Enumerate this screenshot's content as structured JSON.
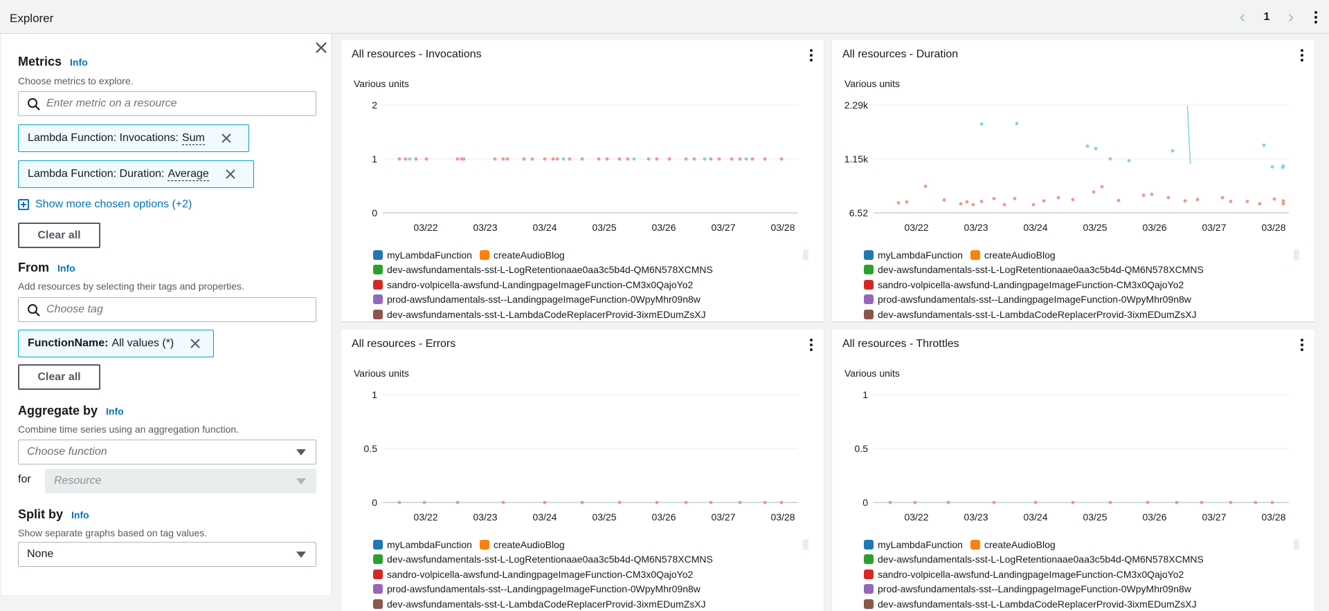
{
  "header": {
    "title": "Explorer",
    "page": "1"
  },
  "sidebar": {
    "metrics": {
      "heading": "Metrics",
      "info": "Info",
      "desc": "Choose metrics to explore.",
      "placeholder": "Enter metric on a resource",
      "tokens": [
        {
          "label": "Lambda Function: Invocations:",
          "stat": "Sum"
        },
        {
          "label": "Lambda Function: Duration:",
          "stat": "Average"
        }
      ],
      "more_link": "Show more chosen options (+2)",
      "clear": "Clear all"
    },
    "from": {
      "heading": "From",
      "info": "Info",
      "desc": "Add resources by selecting their tags and properties.",
      "placeholder": "Choose tag",
      "token_key": "FunctionName:",
      "token_val": "All values (*)",
      "clear": "Clear all"
    },
    "aggregate": {
      "heading": "Aggregate by",
      "info": "Info",
      "desc": "Combine time series using an aggregation function.",
      "function_placeholder": "Choose function",
      "for_label": "for",
      "resource_placeholder": "Resource"
    },
    "split": {
      "heading": "Split by",
      "info": "Info",
      "desc": "Show separate graphs based on tag values.",
      "value": "None"
    }
  },
  "colors": {
    "link": "#0073bb",
    "token_border": "#00a1c9",
    "series_teal": "#7fd3e6",
    "series_salmon": "#f2968c"
  },
  "legend": [
    {
      "name": "myLambdaFunction",
      "color": "#1f77b4"
    },
    {
      "name": "createAudioBlog",
      "color": "#ff7f0e"
    },
    {
      "name": "dev-awsfundamentals-sst-L-LogRetentionaae0aa3c5b4d-QM6N578XCMNS",
      "color": "#2ca02c"
    },
    {
      "name": "sandro-volpicella-awsfund-LandingpageImageFunction-CM3x0QajoYo2",
      "color": "#d62728"
    },
    {
      "name": "prod-awsfundamentals-sst--LandingpageImageFunction-0WpyMhr09n8w",
      "color": "#9467bd"
    },
    {
      "name": "dev-awsfundamentals-sst-L-LambdaCodeReplacerProvid-3ixmEDumZsXJ",
      "color": "#8c564b"
    }
  ],
  "chart_data": [
    {
      "type": "scatter",
      "title": "All resources - Invocations",
      "ylabel": "Various units",
      "ylim": [
        0,
        2
      ],
      "yticks": [
        "0",
        "1",
        "2"
      ],
      "categories": [
        "03/22",
        "03/23",
        "03/24",
        "03/25",
        "03/26",
        "03/27",
        "03/28"
      ],
      "series": [
        {
          "name": "createAudioBlog",
          "color": "#f2968c",
          "points": [
            [
              -1.9,
              1
            ],
            [
              -1.75,
              1
            ],
            [
              -1.5,
              1
            ],
            [
              -1.25,
              1
            ],
            [
              -0.5,
              1
            ],
            [
              -0.4,
              1
            ],
            [
              -0.35,
              1
            ],
            [
              0.4,
              1
            ],
            [
              0.6,
              1
            ],
            [
              0.7,
              1
            ],
            [
              1.1,
              1
            ],
            [
              1.3,
              1
            ],
            [
              1.6,
              1
            ],
            [
              1.8,
              1
            ],
            [
              1.9,
              1
            ],
            [
              2.2,
              1
            ],
            [
              2.5,
              1
            ],
            [
              2.9,
              1
            ],
            [
              3.1,
              1
            ],
            [
              3.4,
              1
            ],
            [
              3.6,
              1
            ],
            [
              4.1,
              1
            ],
            [
              4.3,
              1
            ],
            [
              4.6,
              1
            ],
            [
              5.0,
              1
            ],
            [
              5.2,
              1
            ],
            [
              5.6,
              1
            ],
            [
              5.8,
              1
            ],
            [
              6.1,
              1
            ],
            [
              6.3,
              1
            ],
            [
              6.6,
              1
            ],
            [
              6.9,
              1
            ],
            [
              7.3,
              1
            ]
          ]
        },
        {
          "name": "myLambdaFunction",
          "color": "#7fd3e6",
          "points": [
            [
              -1.65,
              1
            ],
            [
              2.05,
              1
            ],
            [
              3.75,
              1
            ],
            [
              5.45,
              1
            ],
            [
              6.45,
              1
            ]
          ]
        }
      ]
    },
    {
      "type": "scatter",
      "title": "All resources - Duration",
      "ylabel": "Various units",
      "ylim": [
        6.52,
        2290
      ],
      "yticks": [
        "6.52",
        "1.15k",
        "2.29k"
      ],
      "categories": [
        "03/22",
        "03/23",
        "03/24",
        "03/25",
        "03/26",
        "03/27",
        "03/28"
      ],
      "series": [
        {
          "name": "myLambdaFunction",
          "color": "#7fd3e6",
          "points": [
            [
              0.3,
              1890
            ],
            [
              1.15,
              1900
            ],
            [
              2.85,
              1420
            ],
            [
              3.05,
              1370
            ],
            [
              3.4,
              1150
            ],
            [
              3.85,
              1110
            ],
            [
              4.9,
              1320
            ],
            [
              7.1,
              1440
            ],
            [
              7.3,
              980
            ],
            [
              7.55,
              970
            ],
            [
              7.95,
              1000
            ]
          ]
        },
        {
          "name": "createAudioBlog",
          "color": "#f2968c",
          "points": [
            [
              -1.7,
              220
            ],
            [
              -1.5,
              240
            ],
            [
              -1.05,
              570
            ],
            [
              -0.6,
              280
            ],
            [
              -0.2,
              200
            ],
            [
              -0.05,
              240
            ],
            [
              0.1,
              180
            ],
            [
              0.3,
              250
            ],
            [
              0.6,
              310
            ],
            [
              0.85,
              180
            ],
            [
              1.1,
              310
            ],
            [
              1.55,
              180
            ],
            [
              1.8,
              260
            ],
            [
              2.15,
              330
            ],
            [
              2.5,
              290
            ],
            [
              3.0,
              450
            ],
            [
              3.2,
              560
            ],
            [
              3.6,
              270
            ],
            [
              4.2,
              380
            ],
            [
              4.4,
              400
            ],
            [
              4.8,
              330
            ],
            [
              5.2,
              260
            ],
            [
              5.5,
              290
            ],
            [
              6.1,
              330
            ],
            [
              6.3,
              250
            ],
            [
              6.7,
              250
            ],
            [
              7.0,
              200
            ],
            [
              7.35,
              300
            ],
            [
              7.6,
              210
            ],
            [
              7.9,
              260
            ],
            [
              8.05,
              200
            ]
          ]
        }
      ]
    },
    {
      "type": "scatter",
      "title": "All resources - Errors",
      "ylabel": "Various units",
      "ylim": [
        0,
        1
      ],
      "yticks": [
        "0",
        "0.5",
        "1"
      ],
      "categories": [
        "03/22",
        "03/23",
        "03/24",
        "03/25",
        "03/26",
        "03/27",
        "03/28"
      ],
      "series": [
        {
          "name": "createAudioBlog",
          "color": "#f2968c",
          "points": [
            [
              -1.9,
              0
            ],
            [
              -1.3,
              0
            ],
            [
              -0.5,
              0
            ],
            [
              0.6,
              0
            ],
            [
              1.6,
              0
            ],
            [
              2.5,
              0
            ],
            [
              3.4,
              0
            ],
            [
              4.3,
              0
            ],
            [
              5.0,
              0
            ],
            [
              5.6,
              0
            ],
            [
              6.3,
              0
            ],
            [
              6.9,
              0
            ],
            [
              7.3,
              0
            ]
          ]
        }
      ]
    },
    {
      "type": "scatter",
      "title": "All resources - Throttles",
      "ylabel": "Various units",
      "ylim": [
        0,
        1
      ],
      "yticks": [
        "0",
        "0.5",
        "1"
      ],
      "categories": [
        "03/22",
        "03/23",
        "03/24",
        "03/25",
        "03/26",
        "03/27",
        "03/28"
      ],
      "series": [
        {
          "name": "createAudioBlog",
          "color": "#f2968c",
          "points": [
            [
              -1.9,
              0
            ],
            [
              -1.3,
              0
            ],
            [
              -0.5,
              0
            ],
            [
              0.6,
              0
            ],
            [
              1.6,
              0
            ],
            [
              2.5,
              0
            ],
            [
              3.4,
              0
            ],
            [
              4.3,
              0
            ],
            [
              5.0,
              0
            ],
            [
              5.6,
              0
            ],
            [
              6.3,
              0
            ],
            [
              6.9,
              0
            ],
            [
              7.3,
              0
            ]
          ]
        }
      ]
    }
  ]
}
